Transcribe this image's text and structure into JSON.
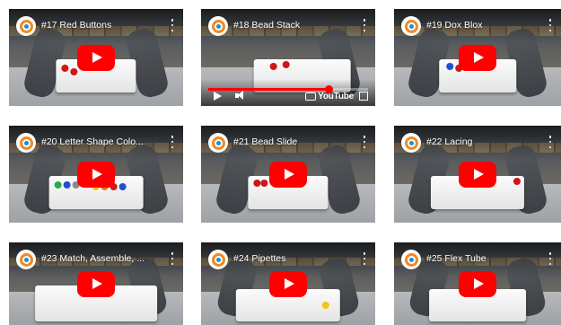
{
  "videos": [
    {
      "title": "#17 Red Buttons"
    },
    {
      "title": "#18 Bead Stack"
    },
    {
      "title": "#19 Dox Blox"
    },
    {
      "title": "#20 Letter Shape Colo..."
    },
    {
      "title": "#21 Bead Slide"
    },
    {
      "title": "#22 Lacing"
    },
    {
      "title": "#23 Match, Assemble, ..."
    },
    {
      "title": "#24 Pipettes"
    },
    {
      "title": "#25 Flex Tube"
    }
  ],
  "player": {
    "brand_label": "YouTube",
    "progress_fraction": 0.75
  },
  "icons": {
    "channel": "channel-avatar-icon",
    "menu": "more-options-icon",
    "play": "youtube-play-icon"
  },
  "colors": {
    "play_button": "#ff0000",
    "avatar_ring": "#f08a24",
    "avatar_center": "#1d8fd1"
  }
}
